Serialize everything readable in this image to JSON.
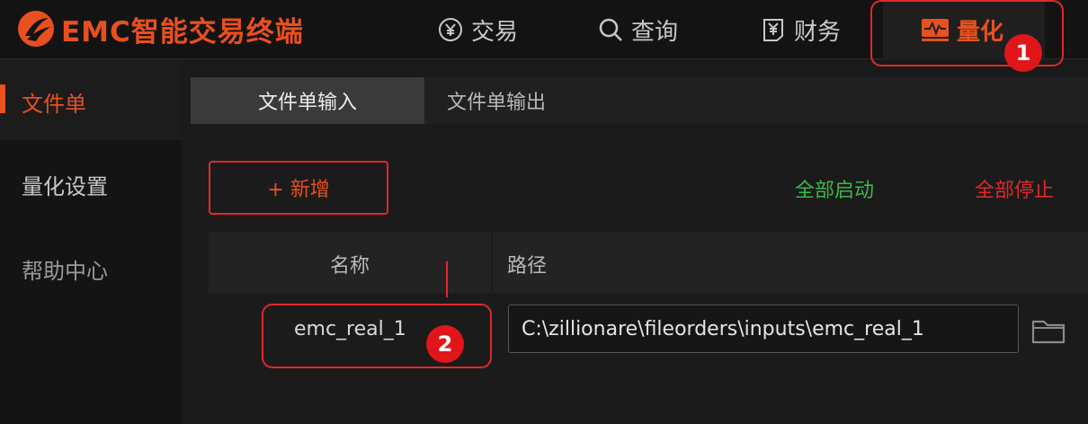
{
  "app": {
    "title": "EMC智能交易终端"
  },
  "nav": {
    "items": [
      {
        "label": "交易",
        "icon": "yen-circle-icon"
      },
      {
        "label": "查询",
        "icon": "search-icon"
      },
      {
        "label": "财务",
        "icon": "finance-doc-icon"
      },
      {
        "label": "量化",
        "icon": "pulse-chart-icon",
        "active": true
      }
    ]
  },
  "sidebar": {
    "items": [
      {
        "label": "文件单",
        "active": true
      },
      {
        "label": "量化设置"
      },
      {
        "label": "帮助中心"
      }
    ]
  },
  "subtabs": [
    {
      "label": "文件单输入",
      "active": true
    },
    {
      "label": "文件单输出"
    }
  ],
  "toolbar": {
    "add_label": "+ 新增",
    "start_all_label": "全部启动",
    "stop_all_label": "全部停止"
  },
  "table": {
    "columns": [
      "名称",
      "路径"
    ],
    "rows": [
      {
        "name": "emc_real_1",
        "path": "C:\\zillionare\\fileorders\\inputs\\emc_real_1"
      }
    ]
  },
  "annotations": [
    {
      "number": "1"
    },
    {
      "number": "2"
    }
  ],
  "colors": {
    "accent": "#e8501e",
    "highlight": "#e0282e",
    "start": "#3fb54a",
    "stop": "#e0282e"
  }
}
